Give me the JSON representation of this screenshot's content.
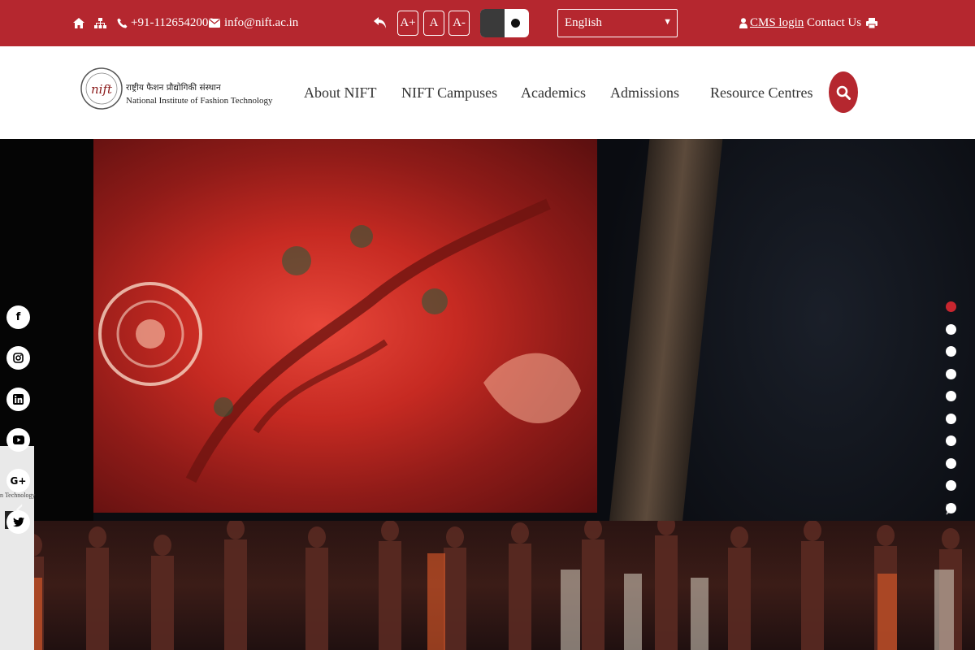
{
  "topbar": {
    "phone": "+91-1126542000",
    "email": "info@nift.ac.in",
    "font_increase": "A+",
    "font_normal": "A",
    "font_decrease": "A-",
    "language_selected": "English",
    "cms_login": "CMS login",
    "contact_us": "Contact Us",
    "icons": [
      "home-icon",
      "sitemap-icon",
      "phone-icon",
      "mail-icon",
      "back-icon",
      "user-icon",
      "print-icon"
    ]
  },
  "header": {
    "logo_hindi": "राष्ट्रीय फैशन प्रौद्योगिकी संस्थान",
    "logo_english": "National Institute of Fashion Technology",
    "logo_mark": "nift",
    "nav": [
      {
        "label": "About NIFT"
      },
      {
        "label": "NIFT Campuses"
      },
      {
        "label": "Academics"
      },
      {
        "label": "Admissions"
      },
      {
        "label": "Resource Centres"
      }
    ]
  },
  "hero": {
    "social": [
      "facebook-icon",
      "instagram-icon",
      "linkedin-icon",
      "youtube-icon",
      "google-plus-icon",
      "twitter-icon"
    ],
    "slides_total": 10,
    "active_slide": 1,
    "side_card_text": "n Technology",
    "side_card_logo": "PC"
  },
  "colors": {
    "brand_red": "#b5272f",
    "active_dot": "#c8262f"
  }
}
